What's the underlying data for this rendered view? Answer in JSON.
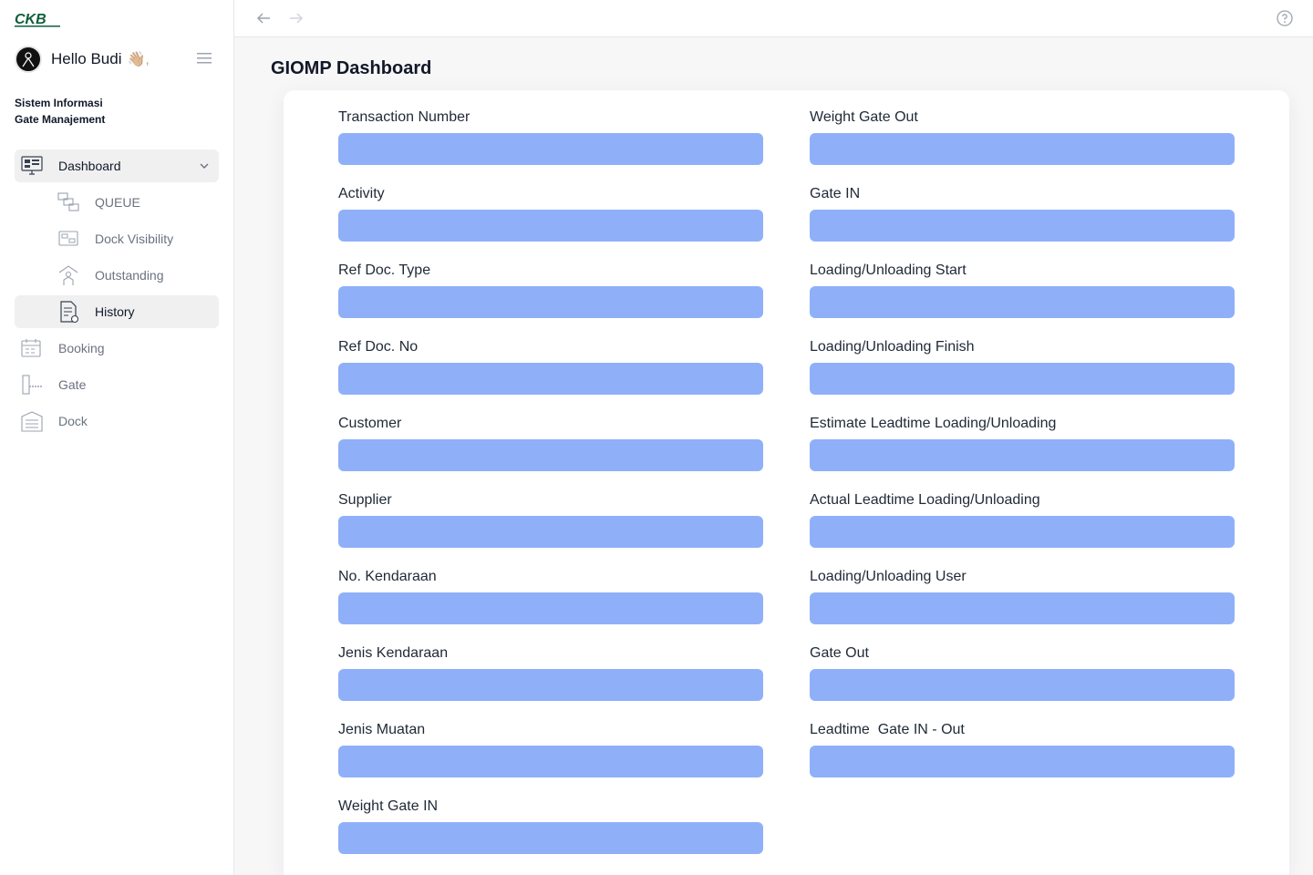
{
  "sidebar": {
    "logo_text": "CKB",
    "greeting": "Hello Budi",
    "wave": "👋🏼,",
    "app_title_line1": "Sistem Informasi",
    "app_title_line2": "Gate Manajement",
    "nav": {
      "dashboard": "Dashboard",
      "queue": "QUEUE",
      "dock_visibility": "Dock Visibility",
      "outstanding": "Outstanding",
      "history": "History",
      "booking": "Booking",
      "gate": "Gate",
      "dock": "Dock"
    }
  },
  "page": {
    "title": "GIOMP Dashboard"
  },
  "form": {
    "left": [
      "Transaction Number",
      "Activity",
      "Ref Doc. Type",
      "Ref Doc. No",
      "Customer",
      "Supplier",
      "No. Kendaraan",
      "Jenis Kendaraan",
      "Jenis Muatan",
      "Weight Gate IN"
    ],
    "right": [
      "Weight Gate Out",
      "Gate IN",
      "Loading/Unloading Start",
      "Loading/Unloading Finish",
      "Estimate Leadtime Loading/Unloading",
      "Actual Leadtime Loading/Unloading",
      "Loading/Unloading User",
      "Gate Out",
      "Leadtime  Gate IN - Out"
    ]
  },
  "colors": {
    "input_fill": "#8fb0f9",
    "brand": "#0f5e3c"
  }
}
